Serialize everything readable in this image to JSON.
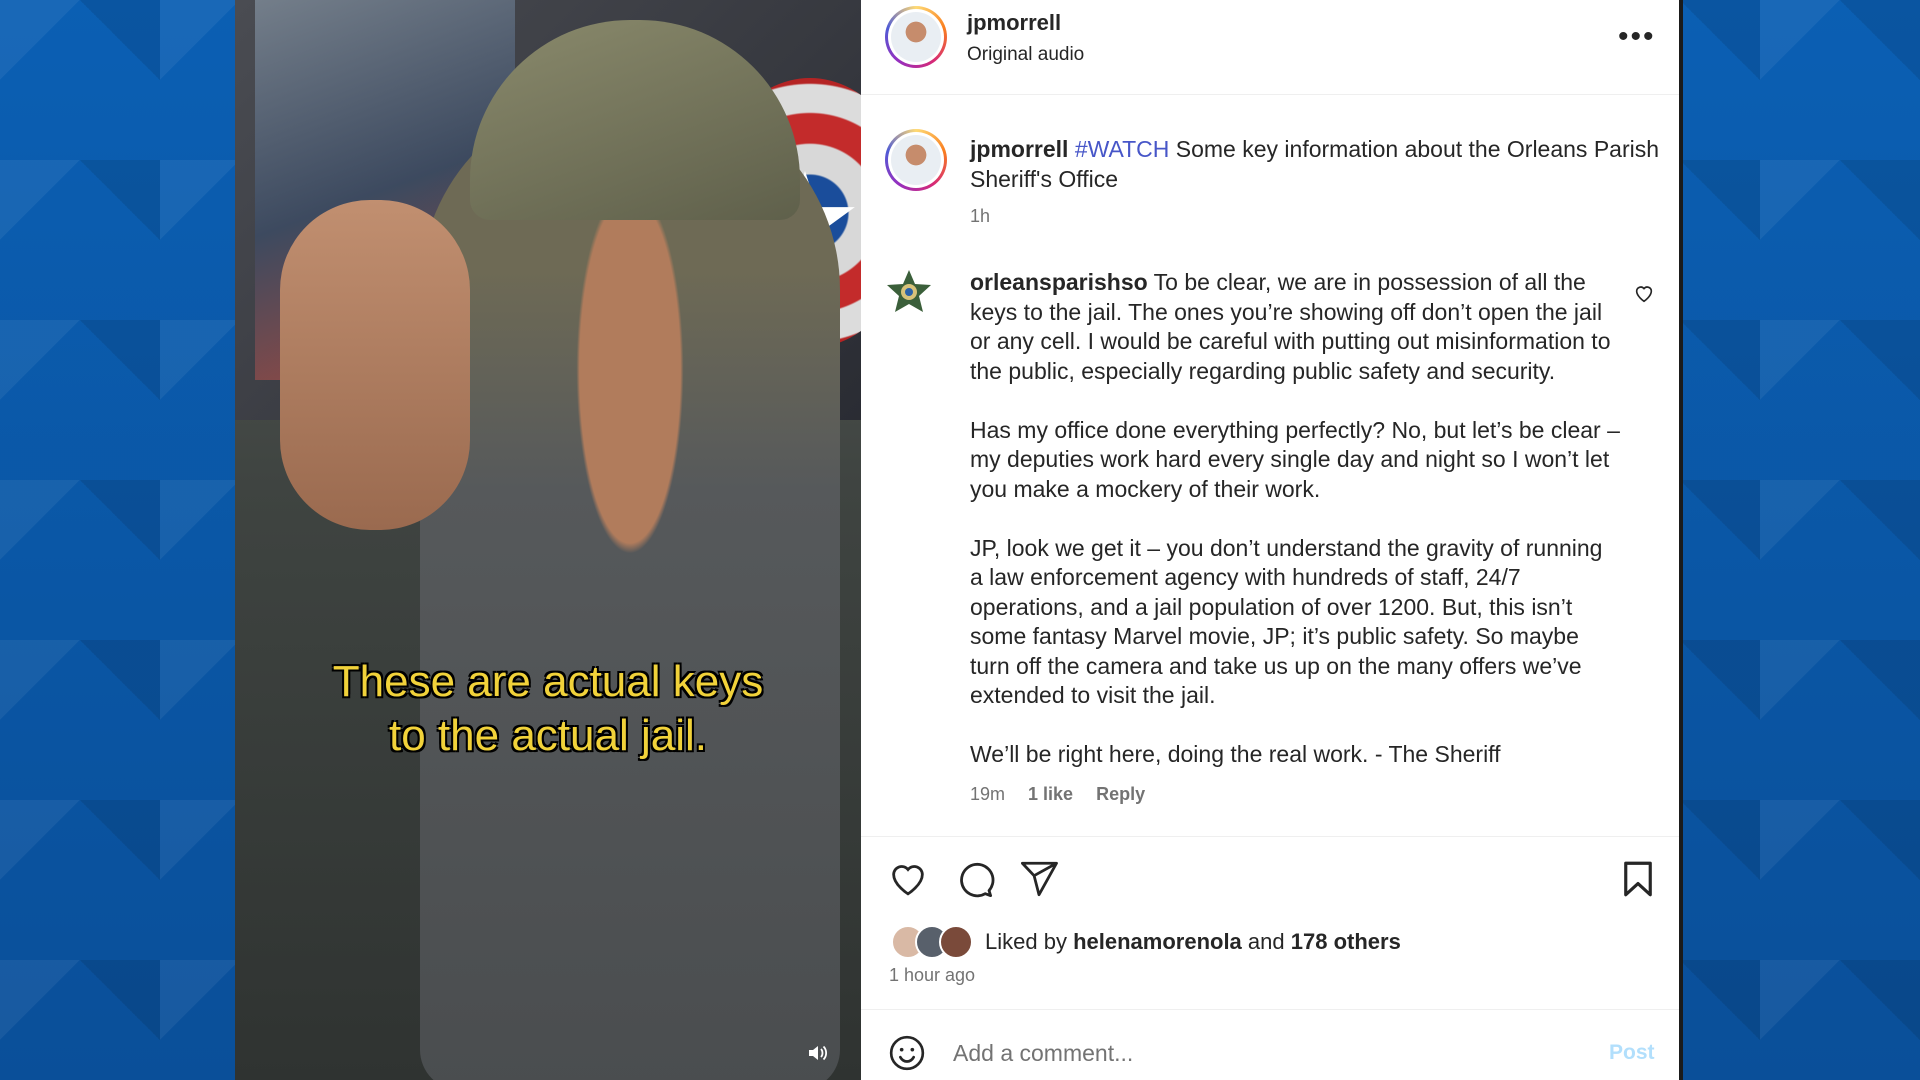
{
  "video": {
    "caption_line1": "These are actual keys",
    "caption_line2": "to the actual jail.",
    "mute_icon": "speaker-icon"
  },
  "header": {
    "username": "jpmorrell",
    "audio": "Original audio",
    "more": "•••"
  },
  "post": {
    "username": "jpmorrell",
    "hashtag": "#WATCH",
    "text": "Some key information about the Orleans Parish Sheriff's Office",
    "time": "1h"
  },
  "comment": {
    "username": "orleansparishso",
    "p1": "To be clear, we are in possession of all the keys to the jail. The ones you’re showing off don’t open the jail or any cell. I would be careful with putting out misinformation to the public, especially regarding public safety and security.",
    "p2": "Has my office done everything perfectly? No, but let’s be clear – my deputies work hard every single day and night so I won’t let you make a mockery of their work.",
    "p3": "JP, look we get it – you don’t understand the gravity of running a law enforcement agency with hundreds of staff, 24/7 operations, and a jail population of over 1200. But, this isn’t some fantasy Marvel movie, JP; it’s public safety. So maybe turn off the camera and take us up on the many offers we’ve extended to visit the jail.",
    "p4": "We’ll be right here, doing the real work. - The Sheriff",
    "time": "19m",
    "likes": "1 like",
    "reply": "Reply"
  },
  "actions": {
    "icons": [
      "heart-icon",
      "comment-icon",
      "share-icon",
      "bookmark-icon"
    ]
  },
  "likes": {
    "prefix": "Liked by",
    "user": "helenamorenola",
    "and": "and",
    "others": "178 others"
  },
  "posted_ago": "1 hour ago",
  "comment_box": {
    "placeholder": "Add a comment...",
    "post_label": "Post"
  },
  "colors": {
    "link": "#4756c8",
    "muted": "#737373",
    "post_disabled": "#b2dffc",
    "caption_yellow": "#f1d23a"
  }
}
